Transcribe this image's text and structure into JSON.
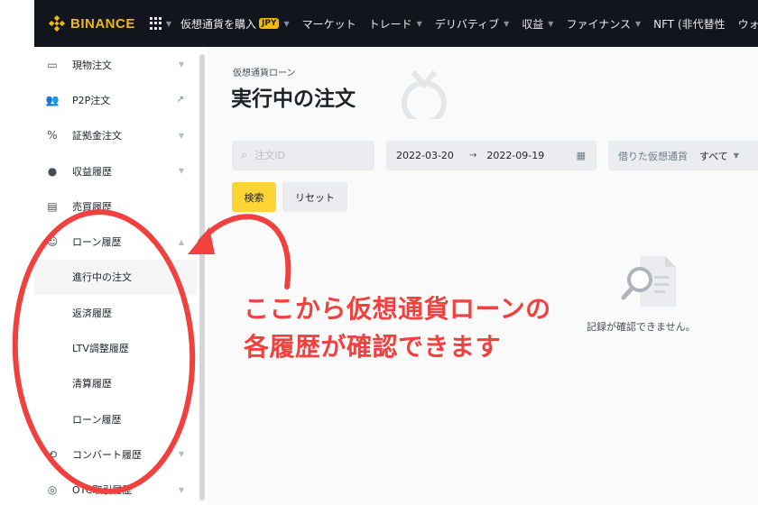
{
  "topbar": {
    "logo_text": "BINANCE",
    "nav": [
      {
        "label": "仮想通貨を購入",
        "badge": "JPY",
        "has_caret": true
      },
      {
        "label": "マーケット",
        "has_caret": false
      },
      {
        "label": "トレード",
        "has_caret": true
      },
      {
        "label": "デリバティブ",
        "has_caret": true
      },
      {
        "label": "収益",
        "has_caret": true
      },
      {
        "label": "ファイナンス",
        "has_caret": true
      },
      {
        "label": "NFT (非代替性",
        "has_caret": false
      },
      {
        "label": "ウォレ",
        "has_caret": false
      }
    ]
  },
  "sidebar": {
    "items": [
      {
        "label": "現物注文",
        "icon": "wallet-icon",
        "trail": "chevron"
      },
      {
        "label": "P2P注文",
        "icon": "users-icon",
        "trail": "external"
      },
      {
        "label": "証拠金注文",
        "icon": "percent-icon",
        "trail": "chevron"
      },
      {
        "label": "収益履歴",
        "icon": "savings-icon",
        "trail": "chevron"
      },
      {
        "label": "売買履歴",
        "icon": "document-icon",
        "trail": "none"
      },
      {
        "label": "ローン履歴",
        "icon": "loan-icon",
        "trail": "chevron-up"
      },
      {
        "label": "進行中の注文",
        "sub": true,
        "active": true
      },
      {
        "label": "返済履歴",
        "sub": true
      },
      {
        "label": "LTV調整履歴",
        "sub": true
      },
      {
        "label": "清算履歴",
        "sub": true
      },
      {
        "label": "ローン履歴",
        "sub": true
      },
      {
        "label": "コンバート履歴",
        "icon": "convert-icon",
        "trail": "chevron"
      },
      {
        "label": "OTC取引履歴",
        "icon": "otc-icon",
        "trail": "chevron"
      }
    ]
  },
  "main": {
    "breadcrumb": "仮想通貨ローン",
    "title": "実行中の注文",
    "search": {
      "placeholder": "注文ID"
    },
    "date_range": {
      "start": "2022-03-20",
      "end": "2022-09-19"
    },
    "coin_filter": {
      "label": "借りた仮想通貨",
      "value": "すべて"
    },
    "buttons": {
      "search": "検索",
      "reset": "リセット"
    },
    "empty_text": "記録が確認できません。"
  },
  "annotation": {
    "line1": "ここから仮想通貨ローンの",
    "line2": "各履歴が確認できます",
    "color": "#f0413f"
  }
}
